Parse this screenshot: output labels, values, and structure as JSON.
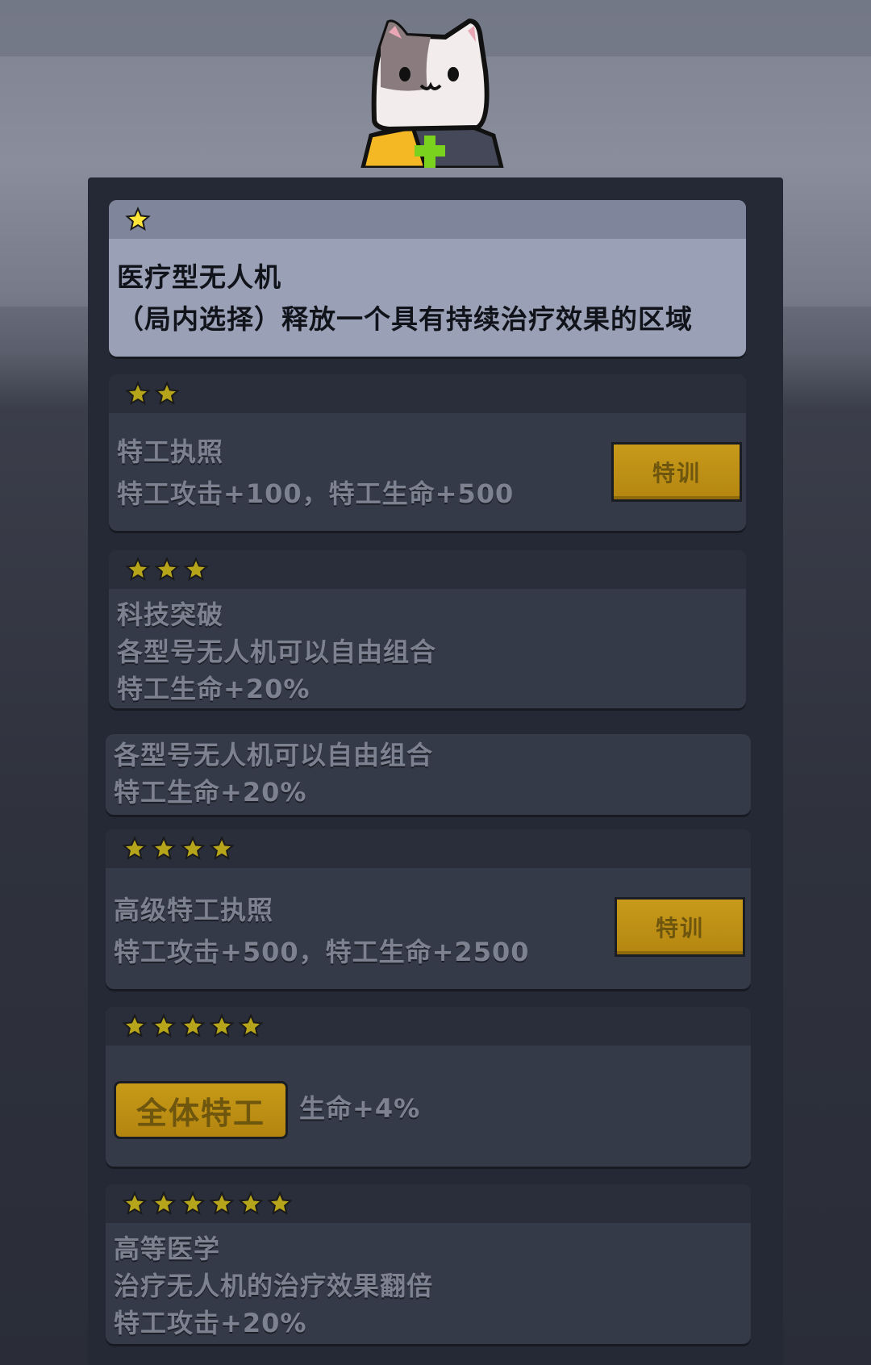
{
  "colors": {
    "star": "#ffe53a",
    "star_dim": "#b6a51b",
    "button": "#b48610"
  },
  "talents": [
    {
      "stars": 1,
      "active": true,
      "title": "医疗型无人机",
      "desc": "（局内选择）释放一个具有持续治疗效果的区域"
    },
    {
      "stars": 2,
      "active": false,
      "title": "特工执照",
      "desc": "特工攻击+100，特工生命+500",
      "button": "特训"
    },
    {
      "stars": 3,
      "active": false,
      "title": "科技突破",
      "line2": "各型号无人机可以自由组合",
      "line3": "特工生命+20%"
    },
    {
      "stars": 0,
      "active": false,
      "line1": "各型号无人机可以自由组合",
      "line2": "特工生命+20%"
    },
    {
      "stars": 4,
      "active": false,
      "title": "高级特工执照",
      "desc": "特工攻击+500，特工生命+2500",
      "button": "特训"
    },
    {
      "stars": 5,
      "active": false,
      "tag": "全体特工",
      "desc": "生命+4%"
    },
    {
      "stars": 6,
      "active": false,
      "title": "高等医学",
      "line2": "治疗无人机的治疗效果翻倍",
      "line3": "特工攻击+20%"
    }
  ]
}
